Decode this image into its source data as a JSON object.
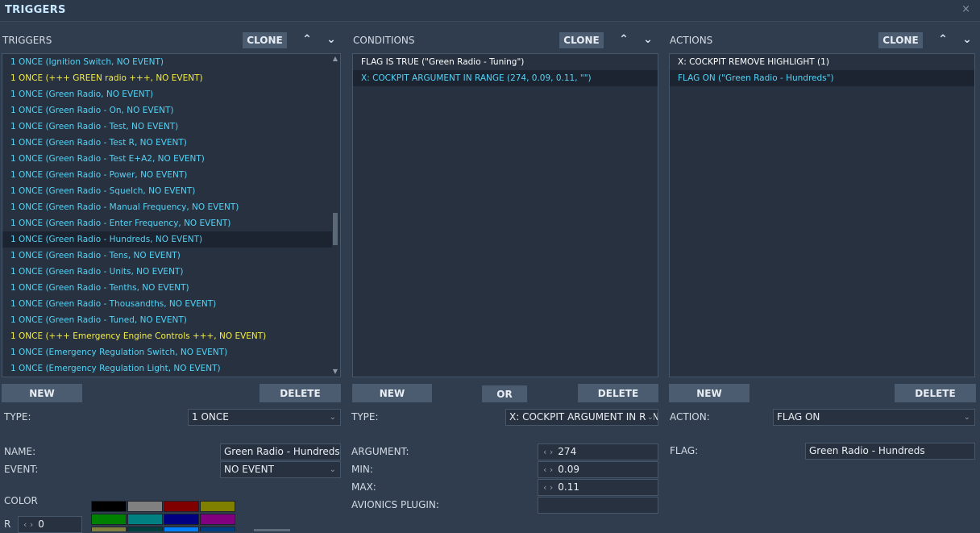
{
  "window": {
    "title": "TRIGGERS",
    "close_glyph": "×"
  },
  "triggers": {
    "header": "TRIGGERS",
    "clone_label": "CLONE",
    "up_glyph": "^",
    "down_glyph": "v",
    "items": [
      {
        "label": "1 ONCE (Ignition Switch, NO EVENT)",
        "style": "cyan"
      },
      {
        "label": "1 ONCE (+++ GREEN radio +++, NO EVENT)",
        "style": "yellow"
      },
      {
        "label": "1 ONCE (Green Radio, NO EVENT)",
        "style": "cyan"
      },
      {
        "label": "1 ONCE (Green Radio - On, NO EVENT)",
        "style": "cyan"
      },
      {
        "label": "1 ONCE (Green Radio - Test, NO EVENT)",
        "style": "cyan"
      },
      {
        "label": "1 ONCE (Green Radio - Test R, NO EVENT)",
        "style": "cyan"
      },
      {
        "label": "1 ONCE (Green Radio - Test E+A2, NO EVENT)",
        "style": "cyan"
      },
      {
        "label": "1 ONCE (Green Radio - Power, NO EVENT)",
        "style": "cyan"
      },
      {
        "label": "1 ONCE (Green Radio - Squelch, NO EVENT)",
        "style": "cyan"
      },
      {
        "label": "1 ONCE (Green Radio - Manual Frequency, NO EVENT)",
        "style": "cyan"
      },
      {
        "label": "1 ONCE (Green Radio - Enter Frequency, NO EVENT)",
        "style": "cyan"
      },
      {
        "label": "1 ONCE (Green Radio - Hundreds, NO EVENT)",
        "style": "cyan",
        "selected": true
      },
      {
        "label": "1 ONCE (Green Radio - Tens, NO EVENT)",
        "style": "cyan"
      },
      {
        "label": "1 ONCE (Green Radio - Units, NO EVENT)",
        "style": "cyan"
      },
      {
        "label": "1 ONCE (Green Radio - Tenths, NO EVENT)",
        "style": "cyan"
      },
      {
        "label": "1 ONCE (Green Radio - Thousandths, NO EVENT)",
        "style": "cyan"
      },
      {
        "label": "1 ONCE (Green  Radio - Tuned, NO EVENT)",
        "style": "cyan"
      },
      {
        "label": "1 ONCE (+++ Emergency Engine Controls +++, NO EVENT)",
        "style": "yellow"
      },
      {
        "label": "1 ONCE (Emergency Regulation Switch, NO EVENT)",
        "style": "cyan"
      },
      {
        "label": "1 ONCE (Emergency Regulation Light, NO EVENT)",
        "style": "cyan"
      }
    ],
    "new_label": "NEW",
    "delete_label": "DELETE",
    "type_label": "TYPE:",
    "type_value": "1 ONCE",
    "name_label": "NAME:",
    "name_value": "Green Radio - Hundreds",
    "event_label": "EVENT:",
    "event_value": "NO EVENT",
    "color_label": "COLOR",
    "r_label": "R",
    "r_value": "0",
    "swatches": [
      "#000000",
      "#808080",
      "#800000",
      "#808000",
      "#008000",
      "#008080",
      "#000080",
      "#800080",
      "#808040",
      "#004040",
      "#0080ff",
      "#004080"
    ]
  },
  "conditions": {
    "header": "CONDITIONS",
    "clone_label": "CLONE",
    "up_glyph": "^",
    "down_glyph": "v",
    "items": [
      {
        "label": "FLAG IS TRUE (\"Green  Radio - Tuning\")",
        "style": "white"
      },
      {
        "label": "X: COCKPIT ARGUMENT IN RANGE (274, 0.09, 0.11, \"\")",
        "style": "cyan",
        "selected": true
      }
    ],
    "new_label": "NEW",
    "or_label": "OR",
    "delete_label": "DELETE",
    "type_label": "TYPE:",
    "type_value": "X: COCKPIT ARGUMENT IN RANGE",
    "argument_label": "ARGUMENT:",
    "argument_value": "274",
    "min_label": "MIN:",
    "min_value": "0.09",
    "max_label": "MAX:",
    "max_value": "0.11",
    "plugin_label": "AVIONICS PLUGIN:",
    "plugin_value": ""
  },
  "actions": {
    "header": "ACTIONS",
    "clone_label": "CLONE",
    "up_glyph": "^",
    "down_glyph": "v",
    "items": [
      {
        "label": "X: COCKPIT REMOVE HIGHLIGHT (1)",
        "style": "white"
      },
      {
        "label": "FLAG ON (\"Green Radio - Hundreds\")",
        "style": "cyan",
        "selected": true
      }
    ],
    "new_label": "NEW",
    "delete_label": "DELETE",
    "action_label": "ACTION:",
    "action_value": "FLAG ON",
    "flag_label": "FLAG:",
    "flag_value": "Green Radio - Hundreds"
  }
}
